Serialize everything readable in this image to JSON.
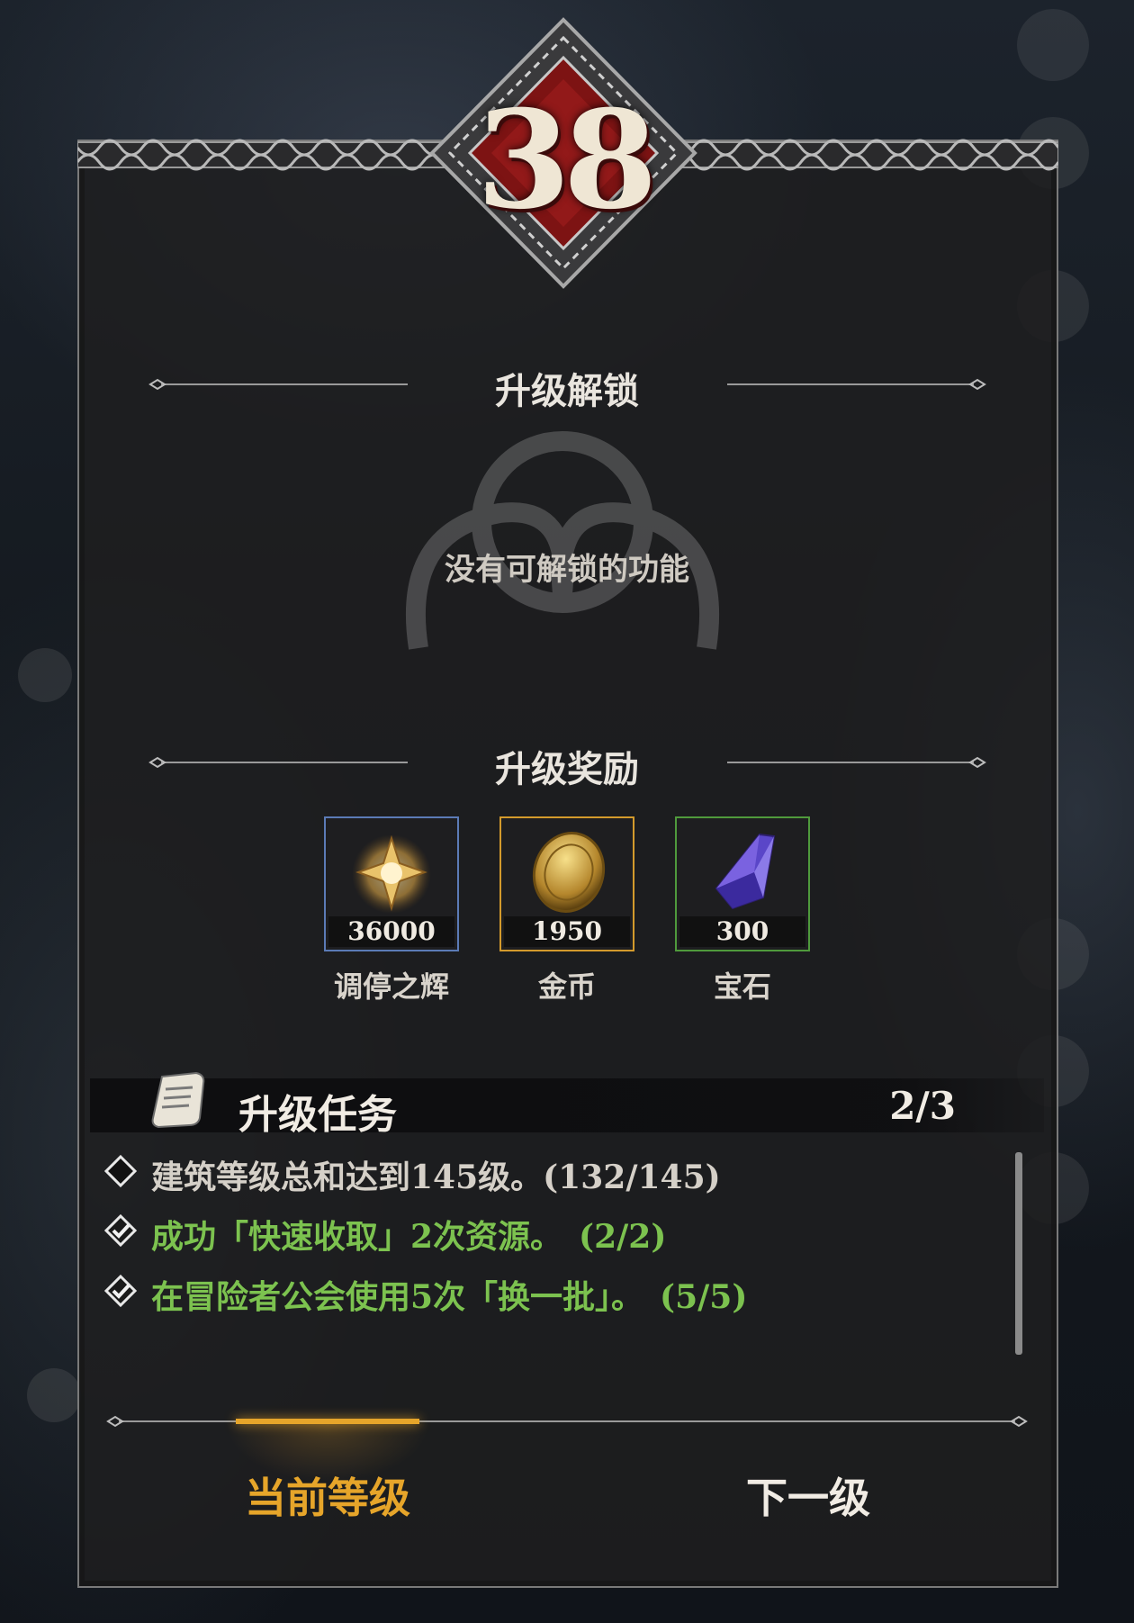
{
  "level": {
    "value": "38"
  },
  "unlock": {
    "title": "升级解锁",
    "empty_text": "没有可解锁的功能"
  },
  "rewards": {
    "title": "升级奖励",
    "items": [
      {
        "name": "调停之辉",
        "count": "36000",
        "icon": "radiance-star-icon",
        "border": "#5b7bb6"
      },
      {
        "name": "金币",
        "count": "1950",
        "icon": "gold-coin-icon",
        "border": "#d39a2c"
      },
      {
        "name": "宝石",
        "count": "300",
        "icon": "gem-crystal-icon",
        "border": "#4f9a3c"
      }
    ]
  },
  "tasks": {
    "title": "升级任务",
    "progress": "2/3",
    "items": [
      {
        "text": "建筑等级总和达到145级。(132/145)",
        "done": false
      },
      {
        "text": "成功「快速收取」2次资源。　(2/2)",
        "done": true
      },
      {
        "text": "在冒险者公会使用5次「换一批」。　(5/5)",
        "done": true
      }
    ]
  },
  "tabs": {
    "current": "当前等级",
    "next": "下一级"
  },
  "colors": {
    "accent_gold": "#e6a52a",
    "task_done": "#7cc24f",
    "task_pending": "#d5d0c8",
    "badge_red": "#8b1414"
  }
}
